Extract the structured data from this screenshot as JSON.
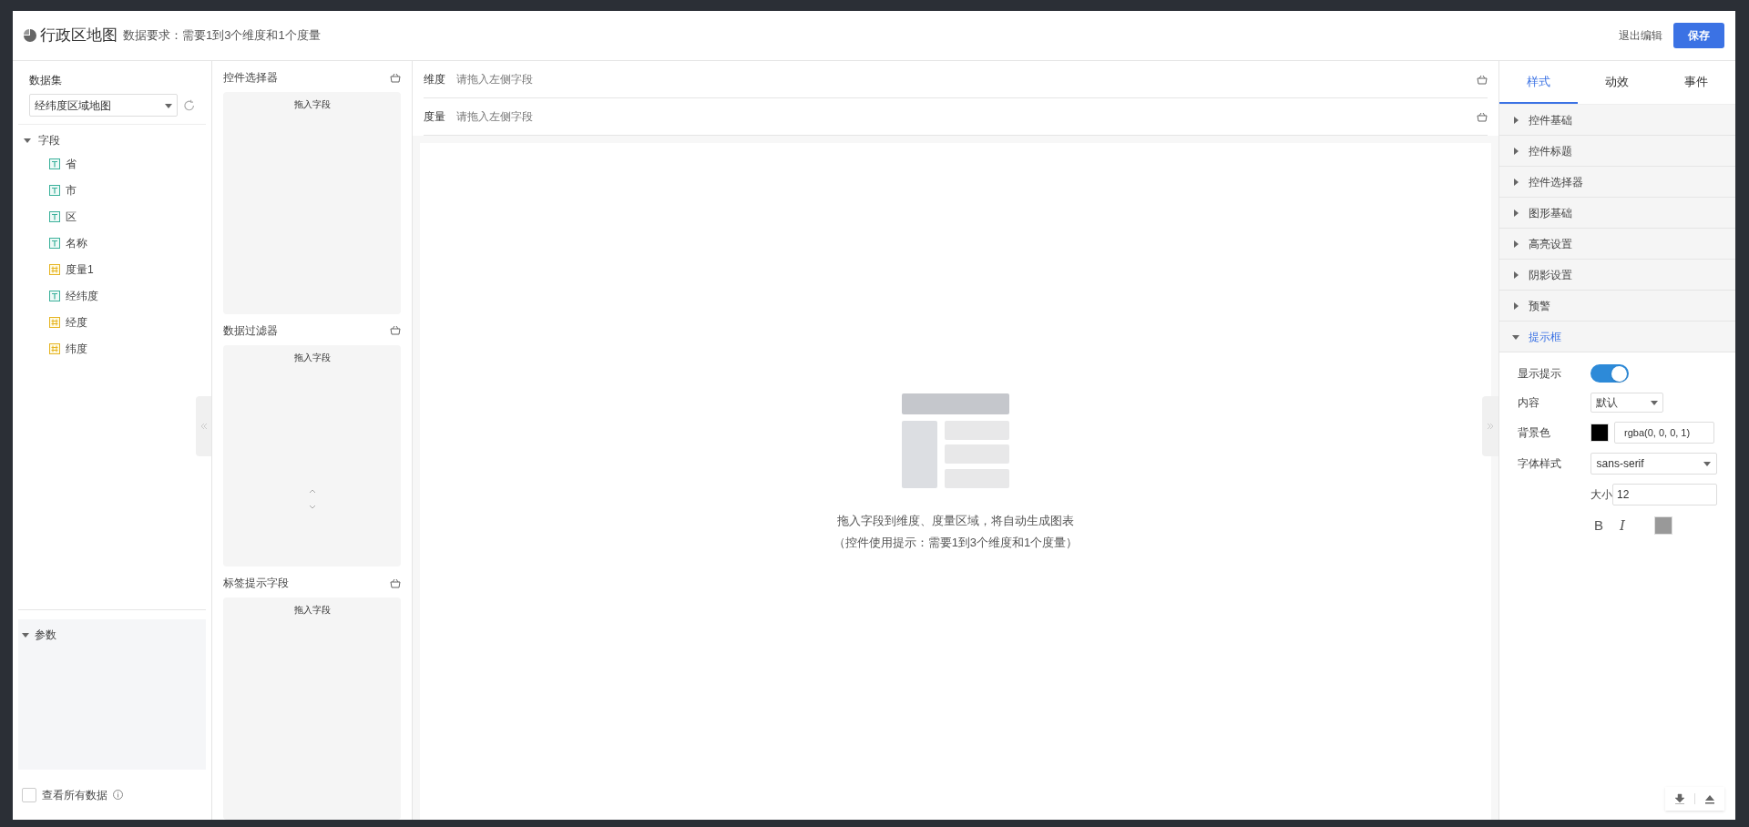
{
  "header": {
    "title": "行政区地图",
    "requirement": "数据要求：需要1到3个维度和1个度量",
    "exit_label": "退出编辑",
    "save_label": "保存"
  },
  "dataset": {
    "label": "数据集",
    "value": "经纬度区域地图"
  },
  "fields": {
    "label": "字段",
    "expanded": true,
    "children": [
      {
        "name": "省",
        "kind": "text"
      },
      {
        "name": "市",
        "kind": "text"
      },
      {
        "name": "区",
        "kind": "text"
      },
      {
        "name": "名称",
        "kind": "text"
      },
      {
        "name": "度量1",
        "kind": "number"
      },
      {
        "name": "经纬度",
        "kind": "text"
      },
      {
        "name": "经度",
        "kind": "number"
      },
      {
        "name": "纬度",
        "kind": "number"
      }
    ]
  },
  "params": {
    "label": "参数",
    "expanded": true
  },
  "view_all": {
    "label": "查看所有数据",
    "checked": false
  },
  "drop_zones": [
    {
      "title": "控件选择器",
      "hint": "拖入字段"
    },
    {
      "title": "数据过滤器",
      "hint": "拖入字段"
    },
    {
      "title": "标签提示字段",
      "hint": "拖入字段"
    }
  ],
  "shelves": [
    {
      "label": "维度",
      "hint": "请拖入左侧字段"
    },
    {
      "label": "度量",
      "hint": "请拖入左侧字段"
    }
  ],
  "empty_state": {
    "line1": "拖入字段到维度、度量区域，将自动生成图表",
    "line2": "（控件使用提示：需要1到3个维度和1个度量）"
  },
  "tabs": [
    {
      "label": "样式",
      "selected": true
    },
    {
      "label": "动效",
      "selected": false
    },
    {
      "label": "事件",
      "selected": false
    }
  ],
  "sections": [
    {
      "label": "控件基础",
      "expanded": false
    },
    {
      "label": "控件标题",
      "expanded": false
    },
    {
      "label": "控件选择器",
      "expanded": false
    },
    {
      "label": "图形基础",
      "expanded": false
    },
    {
      "label": "高亮设置",
      "expanded": false
    },
    {
      "label": "阴影设置",
      "expanded": false
    },
    {
      "label": "预警",
      "expanded": false
    },
    {
      "label": "提示框",
      "expanded": true
    }
  ],
  "tooltip_settings": {
    "show_label": "显示提示",
    "show": true,
    "content_label": "内容",
    "content": "默认",
    "bg_label": "背景色",
    "bg_value": "rgba(0, 0, 0, 1)",
    "font_label": "字体样式",
    "font": "sans-serif",
    "size_label": "大小",
    "size": "12",
    "bold_label": "B",
    "italic_label": "I"
  }
}
